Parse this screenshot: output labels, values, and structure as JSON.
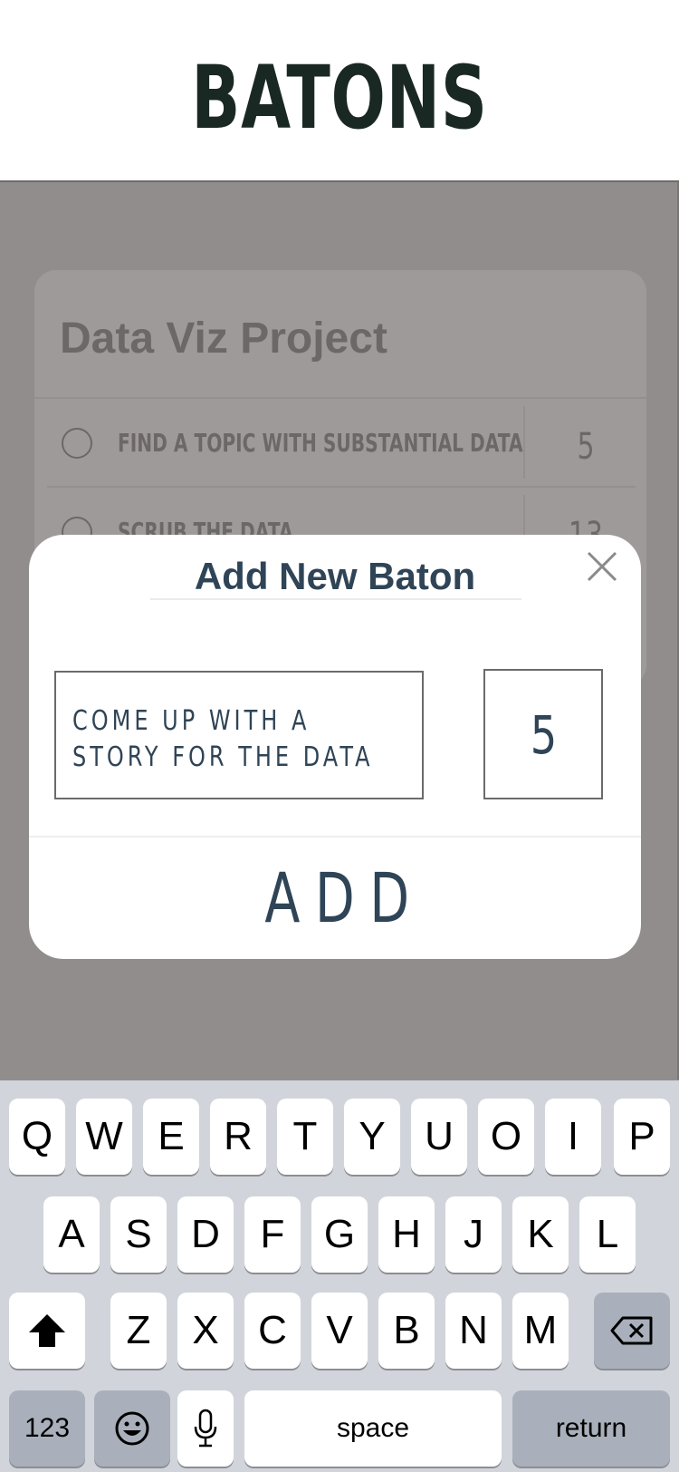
{
  "app": {
    "title": "BATONS"
  },
  "project": {
    "title": "Data Viz Project",
    "tasks": [
      {
        "label": "FIND A TOPIC WITH SUBSTANTIAL DATA",
        "count": "5"
      },
      {
        "label": "SCRUB THE DATA",
        "count": "13"
      }
    ]
  },
  "modal": {
    "title": "Add New Baton",
    "task_value": "COME UP WITH A STORY FOR THE DATA",
    "count_value": "5",
    "add_label": "ADD",
    "close_icon": "close-icon"
  },
  "keyboard": {
    "row1": [
      "Q",
      "W",
      "E",
      "R",
      "T",
      "Y",
      "U",
      "O",
      "I",
      "P"
    ],
    "row2": [
      "A",
      "S",
      "D",
      "F",
      "G",
      "H",
      "J",
      "K",
      "L"
    ],
    "row3": [
      "Z",
      "X",
      "C",
      "V",
      "B",
      "N",
      "M"
    ],
    "numbers_label": "123",
    "space_label": "space",
    "return_label": "return",
    "icons": [
      "shift-icon",
      "backspace-icon",
      "emoji-icon",
      "microphone-icon"
    ]
  },
  "colors": {
    "header_text": "#1a2824",
    "accent_text": "#2f4456",
    "overlay": "#918d8d",
    "keyboard_bg": "#d1d5db"
  }
}
